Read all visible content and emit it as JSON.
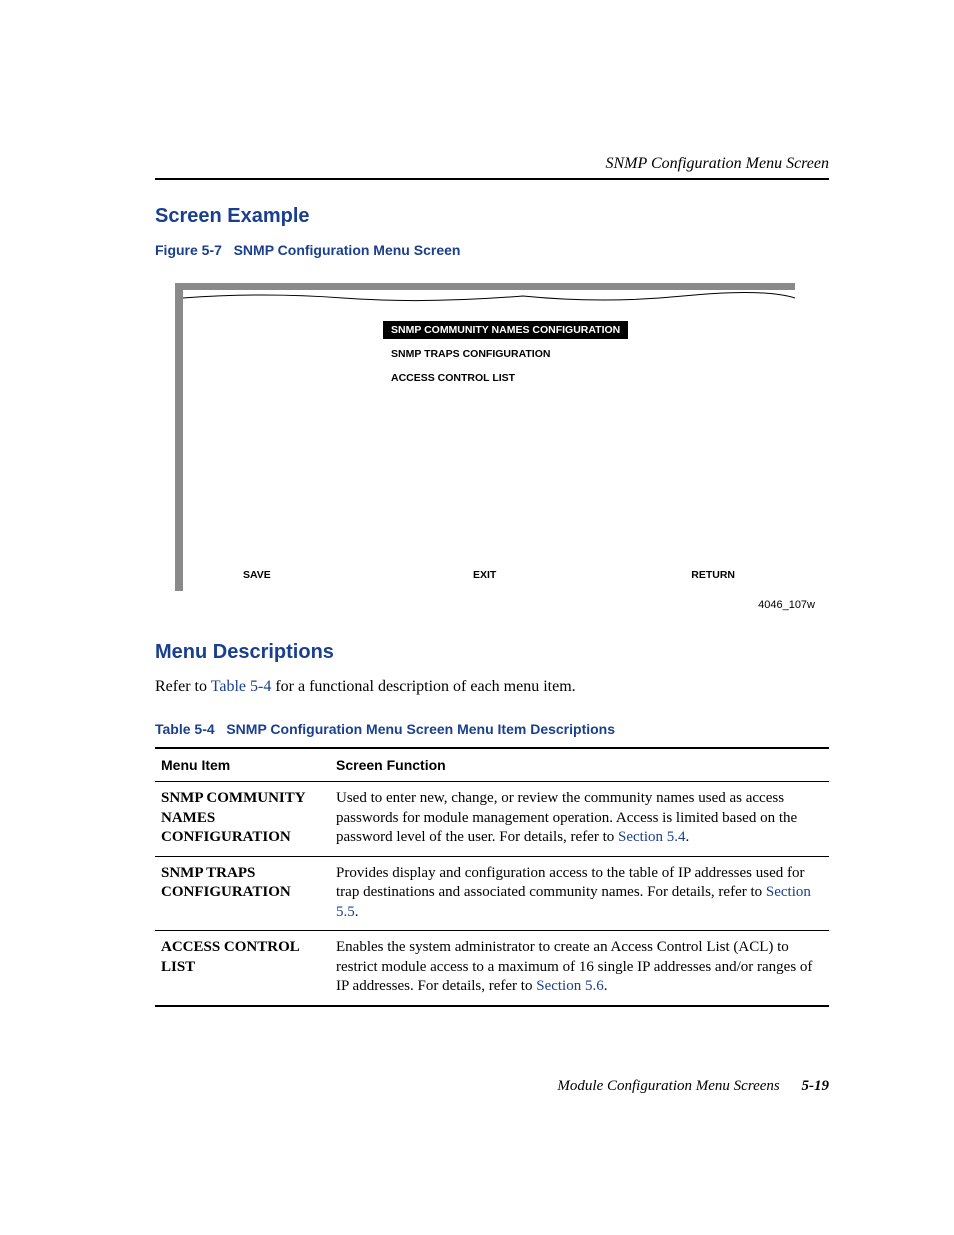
{
  "header": {
    "running_head": "SNMP Configuration Menu Screen"
  },
  "sections": {
    "screen_example": "Screen Example",
    "menu_descriptions": "Menu Descriptions"
  },
  "figure": {
    "caption_prefix": "Figure 5-7",
    "caption_title": "SNMP Configuration Menu Screen",
    "menu_items": {
      "selected": "SNMP COMMUNITY NAMES CONFIGURATION",
      "item2": "SNMP TRAPS CONFIGURATION",
      "item3": "ACCESS CONTROL LIST"
    },
    "buttons": {
      "save": "SAVE",
      "exit": "EXIT",
      "return": "RETURN"
    },
    "id": "4046_107w"
  },
  "menu_desc_intro": {
    "prefix": "Refer to ",
    "link": "Table 5-4",
    "suffix": " for a functional description of each menu item."
  },
  "table": {
    "caption_prefix": "Table 5-4",
    "caption_title": "SNMP Configuration Menu Screen Menu Item Descriptions",
    "headers": {
      "col1": "Menu Item",
      "col2": "Screen Function"
    },
    "rows": [
      {
        "item": "SNMP COMMUNITY NAMES CONFIGURATION",
        "func_pre": "Used to enter new, change, or review the community names used as access passwords for module management operation. Access is limited based on the password level of the user. For details, refer to ",
        "link": "Section 5.4",
        "func_post": "."
      },
      {
        "item": "SNMP TRAPS CONFIGURATION",
        "func_pre": "Provides display and configuration access to the table of IP addresses used for trap destinations and associated community names. For details, refer to ",
        "link": "Section 5.5",
        "func_post": "."
      },
      {
        "item": "ACCESS CONTROL LIST",
        "func_pre": "Enables the system administrator to create an Access Control List (ACL) to restrict module access to a maximum of 16 single IP addresses and/or ranges of IP addresses. For details, refer to ",
        "link": "Section 5.6",
        "func_post": "."
      }
    ]
  },
  "footer": {
    "section": "Module Configuration Menu Screens",
    "page": "5-19"
  }
}
